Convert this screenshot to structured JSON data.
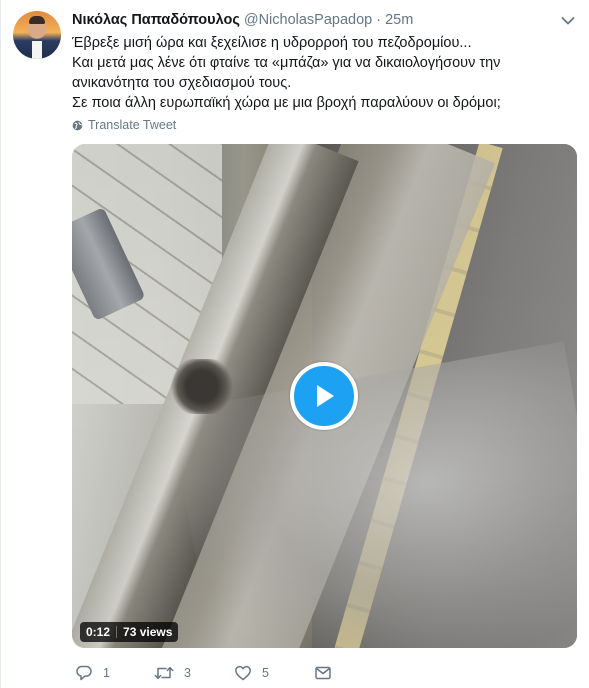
{
  "tweet": {
    "author_name": "Νικόλας Παπαδόπουλος",
    "author_handle": "@NicholasPapadop",
    "separator": "·",
    "timestamp": "25m",
    "lines": [
      "Έβρεξε μισή ώρα και ξεχείλισε η υδρορροή του πεζοδρομίου...",
      "Και μετά μας λένε ότι φταίνε τα «μπάζα» για να δικαιολογήσουν την",
      "ανικανότητα του σχεδιασμού τους.",
      "Σε ποια άλλη ευρωπαϊκή χώρα με μια βροχή παραλύουν οι δρόμοι;"
    ],
    "translate_label": "Translate Tweet"
  },
  "video": {
    "duration": "0:12",
    "views": "73 views"
  },
  "actions": {
    "reply_count": "1",
    "retweet_count": "3",
    "like_count": "5"
  },
  "icons": {
    "avatar": "profile-photo",
    "caret": "chevron-down-icon",
    "translate": "globe-icon",
    "play": "play-icon",
    "reply": "reply-icon",
    "retweet": "retweet-icon",
    "like": "heart-icon",
    "dm": "envelope-icon"
  },
  "colors": {
    "accent": "#1da1f2",
    "text": "#14171a",
    "secondary": "#657786"
  }
}
